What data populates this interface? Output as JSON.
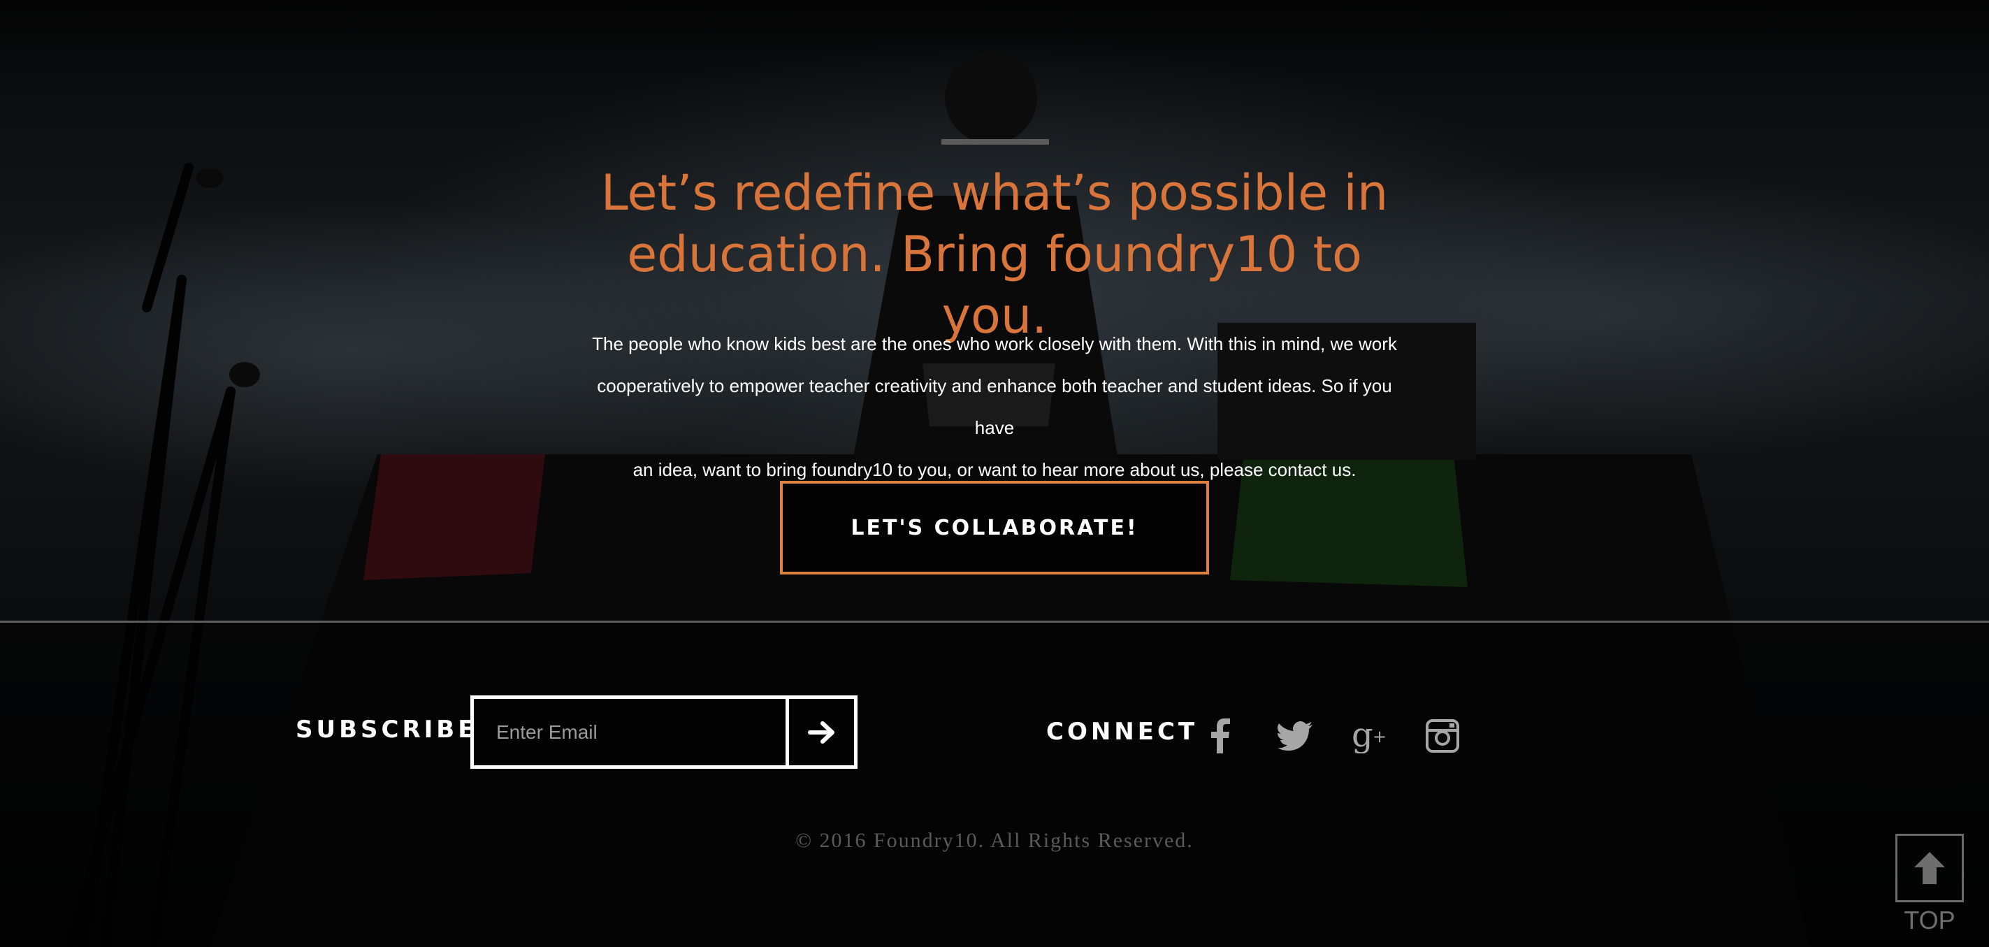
{
  "hero": {
    "headline_line1": "Let’s redefine what’s possible in",
    "headline_line2": "education. Bring foundry10 to you.",
    "body_line1": "The people who know kids best are the ones who work closely with them. With this in mind, we work",
    "body_line2": "cooperatively to empower teacher creativity and enhance both teacher and student ideas. So if you have",
    "body_line3": "an idea, want to bring foundry10 to you, or want to hear more about us, please contact us.",
    "cta_label": "LET'S COLLABORATE!"
  },
  "footer": {
    "subscribe_label": "SUBSCRIBE",
    "email_placeholder": "Enter Email",
    "submit_icon": "arrow-right-icon",
    "connect_label": "CONNECT",
    "social": [
      {
        "name": "facebook-icon"
      },
      {
        "name": "twitter-icon"
      },
      {
        "name": "google-plus-icon"
      },
      {
        "name": "instagram-icon"
      }
    ],
    "copyright": "© 2016 Foundry10. All Rights Reserved."
  },
  "back_to_top": {
    "label": "TOP",
    "icon": "arrow-up-icon"
  },
  "colors": {
    "accent": "#d9753a",
    "button_border": "#e0803f",
    "text": "#ffffff",
    "muted": "#5a5a5a",
    "background": "#050505"
  }
}
